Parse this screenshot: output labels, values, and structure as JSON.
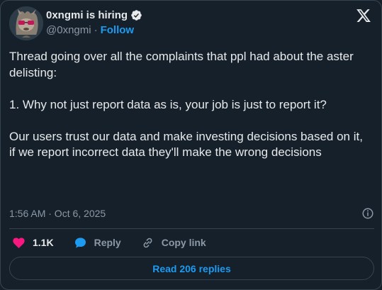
{
  "author": {
    "display_name": "0xngmi is hiring",
    "handle": "@0xngmi",
    "separator": "·",
    "follow_label": "Follow"
  },
  "tweet": {
    "text": "Thread going over all the complaints that ppl had about the aster delisting:\n\n1. Why not just report data as is, your job is just to report it?\n\nOur users trust our data and make investing decisions based on it, if we report incorrect data they'll make the wrong decisions",
    "timestamp": "1:56 AM · Oct 6, 2025"
  },
  "actions": {
    "likes": "1.1K",
    "reply_label": "Reply",
    "copy_link_label": "Copy link"
  },
  "read_replies_label": "Read 206 replies",
  "colors": {
    "background": "#15202b",
    "accent": "#1d9bf0",
    "like": "#f91880",
    "muted": "#8b98a5"
  },
  "icons": [
    "verified-badge-icon",
    "x-logo-icon",
    "info-icon",
    "heart-icon",
    "reply-bubble-icon",
    "link-icon"
  ]
}
